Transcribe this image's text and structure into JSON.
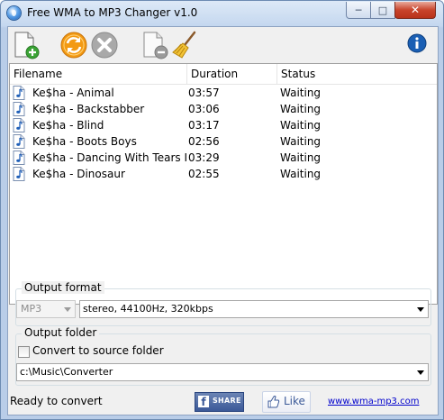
{
  "window": {
    "title": "Free WMA to MP3 Changer v1.0",
    "minimize_glyph": "─",
    "maximize_glyph": "□",
    "close_glyph": "✕"
  },
  "toolbar": {
    "buttons": [
      {
        "name": "add-file-icon"
      },
      {
        "name": "convert-icon"
      },
      {
        "name": "stop-icon"
      },
      {
        "name": "remove-file-icon"
      },
      {
        "name": "clear-list-icon"
      },
      {
        "name": "info-icon"
      }
    ]
  },
  "file_list": {
    "columns": [
      "Filename",
      "Duration",
      "Status"
    ],
    "rows": [
      {
        "filename": "Ke$ha - Animal",
        "duration": "03:57",
        "status": "Waiting"
      },
      {
        "filename": "Ke$ha - Backstabber",
        "duration": "03:06",
        "status": "Waiting"
      },
      {
        "filename": "Ke$ha - Blind",
        "duration": "03:17",
        "status": "Waiting"
      },
      {
        "filename": "Ke$ha - Boots   Boys",
        "duration": "02:56",
        "status": "Waiting"
      },
      {
        "filename": "Ke$ha - Dancing With Tears In...",
        "duration": "03:29",
        "status": "Waiting"
      },
      {
        "filename": "Ke$ha - Dinosaur",
        "duration": "02:55",
        "status": "Waiting"
      }
    ]
  },
  "output_format": {
    "group_label": "Output format",
    "format_value": "MP3",
    "quality_value": "stereo, 44100Hz, 320kbps"
  },
  "output_folder": {
    "group_label": "Output folder",
    "convert_to_source_label": "Convert to source folder",
    "convert_to_source_checked": false,
    "path_value": "c:\\Music\\Converter"
  },
  "status_bar": {
    "status_text": "Ready to convert",
    "share_label": "SHARE",
    "share_icon_letter": "f",
    "like_label": "Like",
    "website_link": "www.wma-mp3.com"
  },
  "colors": {
    "title_gradient_top": "#dde9f7",
    "close_button": "#c8442c",
    "facebook_blue": "#3b5998",
    "link": "#0000cc",
    "add_green": "#3aa335",
    "convert_orange": "#f39a13",
    "info_blue": "#1a5fb4"
  }
}
